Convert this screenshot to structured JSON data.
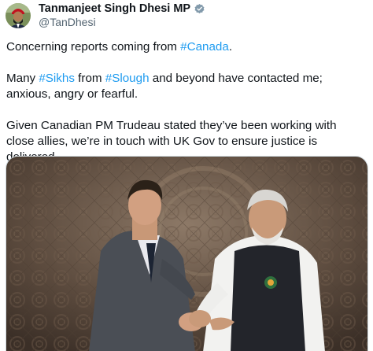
{
  "author": {
    "display_name": "Tanmanjeet Singh Dhesi MP",
    "handle": "@TanDhesi",
    "verified_icon": "verified-badge-icon",
    "verified_color": "#829aab"
  },
  "tweet": {
    "p1_prefix": "Concerning reports coming from ",
    "p1_tag": "#Canada",
    "p1_suffix": ".",
    "p2_prefix": "Many ",
    "p2_tag1": "#Sikhs",
    "p2_mid": " from ",
    "p2_tag2": "#Slough",
    "p2_suffix": " and beyond have contacted me; anxious, angry or fearful.",
    "p3": "Given Canadian PM Trudeau stated they’ve been working with close allies, we’re in touch with UK Gov to ensure justice is delivered.",
    "hashtag_color": "#1d9bf0"
  },
  "media": {
    "type": "photo"
  }
}
